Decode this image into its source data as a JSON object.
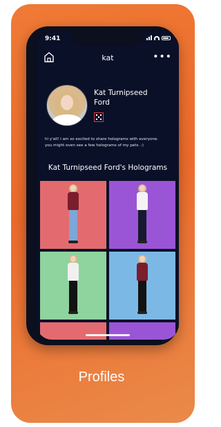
{
  "status_bar": {
    "time": "9:41"
  },
  "header": {
    "username": "kat",
    "home_icon": "home-icon",
    "more_icon": "more-dots-icon"
  },
  "profile": {
    "name_line1": "Kat Turnipseed",
    "name_line2": "Ford",
    "bio_line1": "hi y'all! i am so excited to share holograms with everyone.",
    "bio_line2": "you might even see a few holograms of my pets. :)"
  },
  "holograms": {
    "title": "Kat Turnipseed Ford's Holograms",
    "tiles": [
      {
        "background": "#e36b70",
        "top": "#7a1e2b",
        "bottom": "#7ea6d8"
      },
      {
        "background": "#9a55d6",
        "top": "#f4f4f4",
        "bottom": "#161a2e"
      },
      {
        "background": "#8fd39f",
        "top": "#f0f0f0",
        "bottom": "#121212"
      },
      {
        "background": "#7cb8e6",
        "top": "#7a1e2b",
        "bottom": "#121212"
      }
    ]
  },
  "caption": "Profiles",
  "colors": {
    "accent": "#ec6a2b",
    "screen_bg": "#0a1028"
  }
}
